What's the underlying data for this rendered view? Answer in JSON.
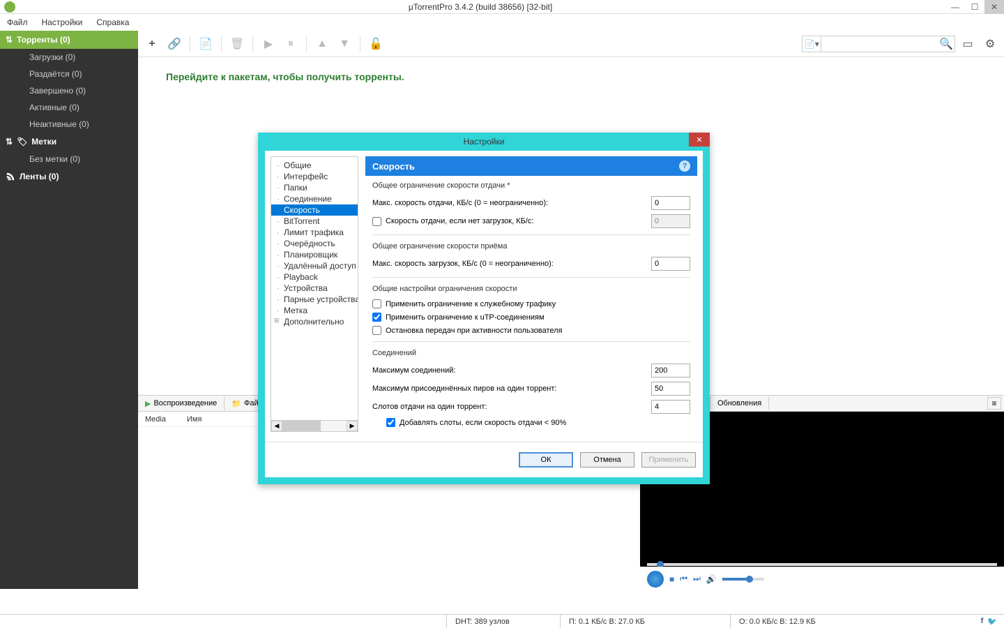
{
  "window_title": "μTorrentPro 3.4.2  (build 38656) [32-bit]",
  "menubar": [
    "Файл",
    "Настройки",
    "Справка"
  ],
  "sidebar": {
    "torrents_header": "Торренты (0)",
    "items": [
      "Загрузки (0)",
      "Раздаётся (0)",
      "Завершено (0)",
      "Активные (0)",
      "Неактивные (0)"
    ],
    "labels_header": "Метки",
    "labels_items": [
      "Без метки (0)"
    ],
    "feeds_header": "Ленты (0)"
  },
  "main_message": "Перейдите к пакетам, чтобы получить торренты.",
  "bottom_tabs": {
    "playback": "Воспроизведение",
    "files": "Фай",
    "updates": "Обновления"
  },
  "table_headers": {
    "media": "Media",
    "name": "Имя"
  },
  "statusbar": {
    "dht": "DHT: 389 узлов",
    "down": "П: 0.1 КБ/с В: 27.0 КБ",
    "up": "О: 0.0 КБ/с В: 12.9 КБ"
  },
  "dialog": {
    "title": "Настройки",
    "tree": [
      "Общие",
      "Интерфейс",
      "Папки",
      "Соединение",
      "Скорость",
      "BitTorrent",
      "Лимит трафика",
      "Очерёдность",
      "Планировщик",
      "Удалённый доступ",
      "Playback",
      "Устройства",
      "Парные устройства",
      "Метка",
      "Дополнительно"
    ],
    "tree_selected_index": 4,
    "panel_title": "Скорость",
    "groups": {
      "upload": {
        "title": "Общее ограничение скорости отдачи *",
        "max_up_label": "Макс. скорость отдачи, КБ/с (0 = неограниченно):",
        "max_up_value": "0",
        "alt_up_label": "Скорость отдачи, если нет загрузок, КБ/с:",
        "alt_up_value": "0"
      },
      "download": {
        "title": "Общее ограничение скорости приёма",
        "max_down_label": "Макс. скорость загрузок, КБ/с (0 = неограниченно):",
        "max_down_value": "0"
      },
      "global": {
        "title": "Общие настройки ограничения скорости",
        "overhead_label": "Применить ограничение к служебному трафику",
        "utp_label": "Применить ограничение к uTP-соединениям",
        "stop_label": "Остановка передач при активности пользователя"
      },
      "conn": {
        "title": "Соединений",
        "max_conn_label": "Максимум соединений:",
        "max_conn_value": "200",
        "max_peers_label": "Максимум присоединённых пиров на один торрент:",
        "max_peers_value": "50",
        "slots_label": "Слотов отдачи на один торрент:",
        "slots_value": "4",
        "add_slots_label": "Добавлять слоты, если скорость отдачи < 90%"
      }
    },
    "buttons": {
      "ok": "ОК",
      "cancel": "Отмена",
      "apply": "Применить"
    }
  }
}
